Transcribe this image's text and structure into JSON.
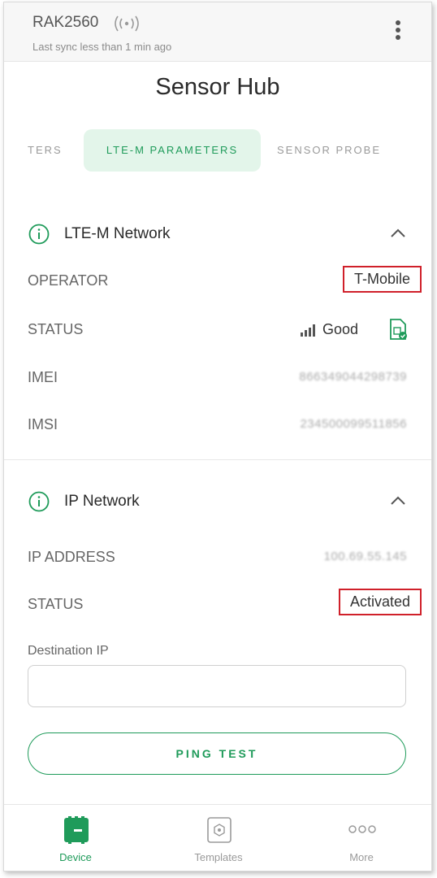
{
  "header": {
    "device_name": "RAK2560",
    "sync_status": "Last sync less than 1 min ago"
  },
  "page": {
    "title": "Sensor Hub"
  },
  "tabs": [
    {
      "label": "TERS",
      "active": false
    },
    {
      "label": "LTE-M PARAMETERS",
      "active": true
    },
    {
      "label": "SENSOR PROBE",
      "active": false
    }
  ],
  "lte_section": {
    "title": "LTE-M Network",
    "operator_label": "OPERATOR",
    "operator_value": "T-Mobile",
    "status_label": "STATUS",
    "status_value": "Good",
    "imei_label": "IMEI",
    "imei_value": "866349044298739",
    "imsi_label": "IMSI",
    "imsi_value": "234500099511856"
  },
  "ip_section": {
    "title": "IP Network",
    "ip_label": "IP ADDRESS",
    "ip_value": "100.69.55.145",
    "status_label": "STATUS",
    "status_value": "Activated",
    "dest_label": "Destination IP",
    "dest_value": "",
    "ping_label": "PING TEST"
  },
  "bottom_nav": [
    {
      "label": "Device",
      "icon": "device-icon",
      "active": true
    },
    {
      "label": "Templates",
      "icon": "templates-icon",
      "active": false
    },
    {
      "label": "More",
      "icon": "more-icon",
      "active": false
    }
  ],
  "colors": {
    "accent": "#1f9b5a",
    "highlight_border": "#d0202a",
    "tab_active_bg": "#e3f5ea"
  }
}
